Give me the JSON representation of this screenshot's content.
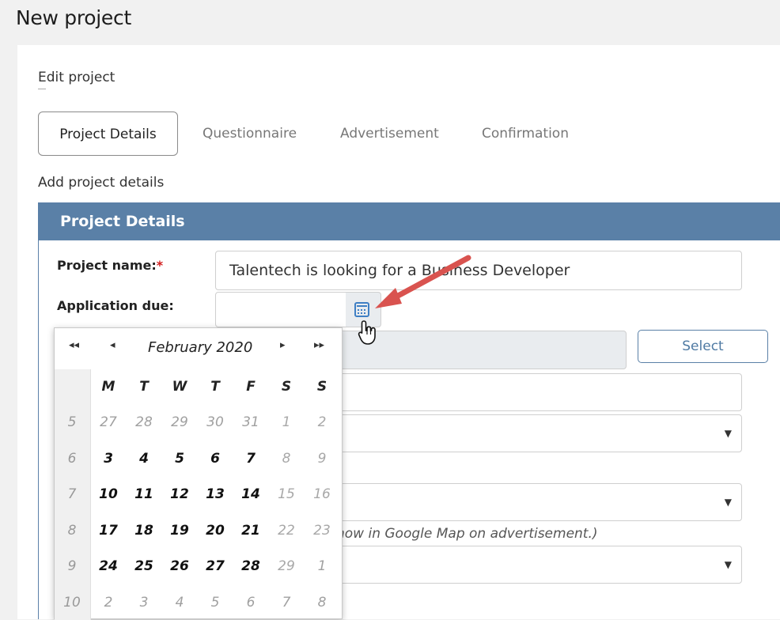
{
  "page": {
    "title": "New project"
  },
  "card": {
    "edit_label": "Edit project",
    "sub_label": "Add project details"
  },
  "tabs": [
    {
      "label": "Project Details",
      "active": true
    },
    {
      "label": "Questionnaire",
      "active": false
    },
    {
      "label": "Advertisement",
      "active": false
    },
    {
      "label": "Confirmation",
      "active": false
    }
  ],
  "panel": {
    "title": "Project Details",
    "project_name_label": "Project name:",
    "required_mark": "*",
    "project_name_value": "Talentech is looking for a Business Developer",
    "application_due_label": "Application due:",
    "application_due_value": "",
    "select_button": "Select",
    "map_hint": "how in Google Map on advertisement.)"
  },
  "calendar": {
    "month_label": "February 2020",
    "nav": {
      "first": "◂◂",
      "prev": "◂",
      "next": "▸",
      "last": "▸▸"
    },
    "weekdays": [
      "M",
      "T",
      "W",
      "T",
      "F",
      "S",
      "S"
    ],
    "weeks": [
      {
        "week": "5",
        "days": [
          "27",
          "28",
          "29",
          "30",
          "31",
          "1",
          "2"
        ],
        "kinds": [
          "o",
          "o",
          "o",
          "o",
          "o",
          "w",
          "w"
        ]
      },
      {
        "week": "6",
        "days": [
          "3",
          "4",
          "5",
          "6",
          "7",
          "8",
          "9"
        ],
        "kinds": [
          "c",
          "c",
          "c",
          "c",
          "c",
          "w",
          "w"
        ]
      },
      {
        "week": "7",
        "days": [
          "10",
          "11",
          "12",
          "13",
          "14",
          "15",
          "16"
        ],
        "kinds": [
          "c",
          "c",
          "c",
          "c",
          "c",
          "w",
          "w"
        ]
      },
      {
        "week": "8",
        "days": [
          "17",
          "18",
          "19",
          "20",
          "21",
          "22",
          "23"
        ],
        "kinds": [
          "c",
          "c",
          "c",
          "c",
          "c",
          "w",
          "w"
        ]
      },
      {
        "week": "9",
        "days": [
          "24",
          "25",
          "26",
          "27",
          "28",
          "29",
          "1"
        ],
        "kinds": [
          "c",
          "c",
          "c",
          "c",
          "c",
          "w",
          "o"
        ]
      },
      {
        "week": "10",
        "days": [
          "2",
          "3",
          "4",
          "5",
          "6",
          "7",
          "8"
        ],
        "kinds": [
          "o",
          "o",
          "o",
          "o",
          "o",
          "o",
          "o"
        ]
      }
    ]
  },
  "colors": {
    "panel_header": "#5a80a7",
    "required": "#d11a1a",
    "annotation_arrow": "#d9534f",
    "calendar_icon": "#3f7fc4"
  },
  "icons": {
    "date_button": "calendar-icon",
    "pointer": "hand-cursor-icon",
    "annotation": "red-arrow-icon"
  }
}
